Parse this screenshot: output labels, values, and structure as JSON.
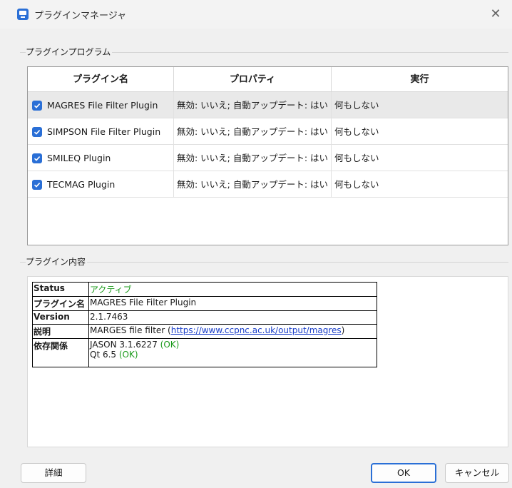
{
  "window": {
    "title": "プラグインマネージャ",
    "close_glyph": "✕",
    "icon": "plugin-app-icon"
  },
  "programs_group": {
    "label": "プラグインプログラム",
    "columns": [
      "プラグイン名",
      "プロパティ",
      "実行"
    ],
    "rows": [
      {
        "checked": true,
        "name": "MAGRES File Filter Plugin",
        "properties": "無効: いいえ; 自動アップデート: はい",
        "action": "何もしない"
      },
      {
        "checked": true,
        "name": "SIMPSON File Filter Plugin",
        "properties": "無効: いいえ; 自動アップデート: はい",
        "action": "何もしない"
      },
      {
        "checked": true,
        "name": "SMILEQ Plugin",
        "properties": "無効: いいえ; 自動アップデート: はい",
        "action": "何もしない"
      },
      {
        "checked": true,
        "name": "TECMAG Plugin",
        "properties": "無効: いいえ; 自動アップデート: はい",
        "action": "何もしない"
      }
    ]
  },
  "content_group": {
    "label": "プラグイン内容",
    "status_key": "Status",
    "status_val": "アクティブ",
    "name_key": "プラグイン名",
    "name_val": "MAGRES File Filter Plugin",
    "version_key": "Version",
    "version_val": "2.1.7463",
    "desc_key": "説明",
    "desc_prefix": "MARGES file filter (",
    "desc_link": "https://www.ccpnc.ac.uk/output/magres",
    "desc_suffix": ")",
    "deps_key": "依存関係",
    "dep1_name": "JASON 3.1.6227 ",
    "dep1_status": "(OK)",
    "dep2_name": "Qt 6.5 ",
    "dep2_status": "(OK)"
  },
  "buttons": {
    "details": "詳細",
    "ok": "OK",
    "cancel": "キャンセル"
  },
  "colors": {
    "accent": "#2a6fd6",
    "ok_green": "#1a9a1a",
    "link_blue": "#1a3ec9"
  }
}
